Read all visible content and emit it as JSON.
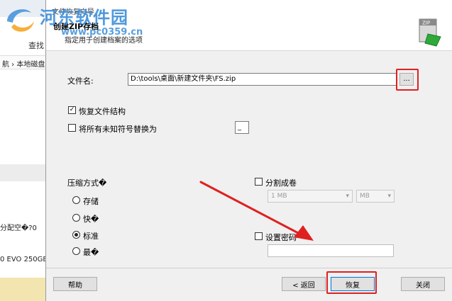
{
  "background": {
    "search_label": "查找",
    "address_text": "航 › 本地磁盘",
    "alloc_text": "分配空�?0",
    "disk_text": "0 EVO 250GB"
  },
  "watermark": {
    "site_name": "河东软件园",
    "url": "www.pc0359.cn"
  },
  "dialog": {
    "window_title": "文件恢复向导",
    "header_title": "创建ZIP存档",
    "header_subtitle": "指定用于创建档案的选项",
    "file_name_label": "文件名:",
    "file_name_value": "D:\\tools\\桌面\\新建文件夹\\FS.zip",
    "browse_label": "...",
    "restore_structure_label": "恢复文件结构",
    "restore_structure_checked": true,
    "replace_unknown_label": "将所有未知符号替换为",
    "replace_unknown_checked": false,
    "replace_char_value": "_",
    "compression": {
      "label": "压缩方式�",
      "options": [
        {
          "label": "存储",
          "selected": false
        },
        {
          "label": "快�",
          "selected": false
        },
        {
          "label": "标准",
          "selected": true
        },
        {
          "label": "最�",
          "selected": false
        }
      ]
    },
    "split_volume": {
      "label": "分割成卷",
      "checked": false,
      "size_value": "1 MB",
      "unit_value": "MB"
    },
    "password": {
      "label": "设置密码",
      "checked": false,
      "value": ""
    },
    "buttons": {
      "help": "帮助",
      "back": "< 返回",
      "restore": "恢复",
      "close": "关闭"
    }
  },
  "colors": {
    "highlight": "#e02020",
    "watermark": "#3d8fd9",
    "dialog_bg": "#f0f0f0"
  }
}
